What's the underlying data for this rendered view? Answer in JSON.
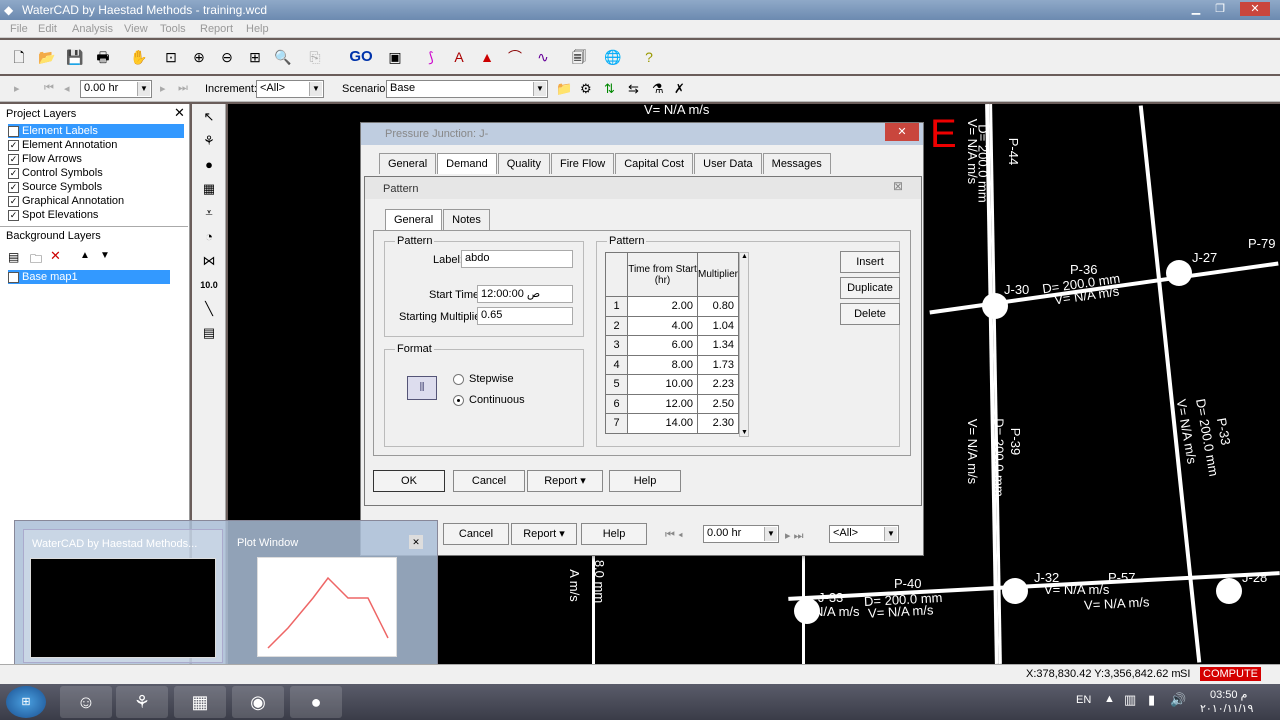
{
  "app": {
    "title": "WaterCAD by Haestad Methods - training.wcd"
  },
  "menu": [
    "File",
    "Edit",
    "Analysis",
    "View",
    "Tools",
    "Report",
    "Help"
  ],
  "toolbar": {
    "go_label": "GO"
  },
  "toolbar2": {
    "time": "0.00 hr",
    "increment_label": "Increment:",
    "increment": "<All>",
    "scenario_label": "Scenario:",
    "scenario": "Base"
  },
  "project_layers": {
    "title": "Project Layers",
    "items": [
      "Element Labels",
      "Element Annotation",
      "Flow Arrows",
      "Control Symbols",
      "Source Symbols",
      "Graphical Annotation",
      "Spot Elevations"
    ],
    "bg_title": "Background Layers",
    "bg_items": [
      "Base map1"
    ]
  },
  "canvas_labels": {
    "v1": "V= N/A m/s",
    "e": "E",
    "p44": "P-44",
    "d1": "D= 200.0 mm",
    "v2": "V= N/A m/s",
    "p36": "P-36",
    "j30": "J-30",
    "d2": "D= 200.0 mm",
    "v3": "V= N/A m/s",
    "j27": "J-27",
    "p79": "P-79",
    "p39": "P-39",
    "d3": "D= 200.0 mm",
    "v4": "V= N/A m/s",
    "p33": "P-33",
    "d4": "D= 200.0 mm",
    "v5": "V= N/A m/s",
    "j32": "J-32",
    "p57": "P-57",
    "p40": "P-40",
    "d5": "D= 200.0 mm",
    "v6": "V= N/A m/s",
    "j33": "J-33",
    "v7": "V= N/A m/s",
    "j28": "J-28",
    "v8": "V= N/A m/s",
    "j32t": "J-32",
    "nam": "N/A m/s",
    "mm8": "8.0 mm",
    "ams": "A m/s"
  },
  "junction_dialog": {
    "title": "Pressure Junction: J-",
    "tabs": [
      "General",
      "Demand",
      "Quality",
      "Fire Flow",
      "Capital Cost",
      "User Data",
      "Messages"
    ],
    "cancel": "Cancel",
    "report": "Report",
    "help": "Help",
    "time": "0.00 hr",
    "all": "<All>"
  },
  "pattern_dialog": {
    "title": "Pattern",
    "tabs": [
      "General",
      "Notes"
    ],
    "pattern_group": "Pattern",
    "label_label": "Label:",
    "label_value": "abdo",
    "start_time_label": "Start Time:",
    "start_time": "12:00:00 ص",
    "start_mult_label": "Starting Multiplier:",
    "start_mult": "0.65",
    "format_group": "Format",
    "stepwise": "Stepwise",
    "continuous": "Continuous",
    "table_group": "Pattern",
    "col_time": "Time from Start (hr)",
    "col_mult": "Multiplier",
    "rows": [
      {
        "n": "1",
        "t": "2.00",
        "m": "0.80"
      },
      {
        "n": "2",
        "t": "4.00",
        "m": "1.04"
      },
      {
        "n": "3",
        "t": "6.00",
        "m": "1.34"
      },
      {
        "n": "4",
        "t": "8.00",
        "m": "1.73"
      },
      {
        "n": "5",
        "t": "10.00",
        "m": "2.23"
      },
      {
        "n": "6",
        "t": "12.00",
        "m": "2.50"
      },
      {
        "n": "7",
        "t": "14.00",
        "m": "2.30"
      }
    ],
    "insert": "Insert",
    "duplicate": "Duplicate",
    "delete": "Delete",
    "ok": "OK",
    "cancel": "Cancel",
    "report": "Report",
    "help": "Help"
  },
  "thumbnails": [
    {
      "title": "WaterCAD by Haestad Methods..."
    },
    {
      "title": "Plot Window"
    }
  ],
  "status": {
    "coords": "X:378,830.42 Y:3,356,842.62 m",
    "si": "SI",
    "compute": "COMPUTE"
  },
  "tray": {
    "lang": "EN",
    "time": "03:50 م",
    "date": "٢٠١٠/١١/١٩"
  },
  "colors": {
    "compute": "#d40000",
    "accent": "#3399ff"
  }
}
